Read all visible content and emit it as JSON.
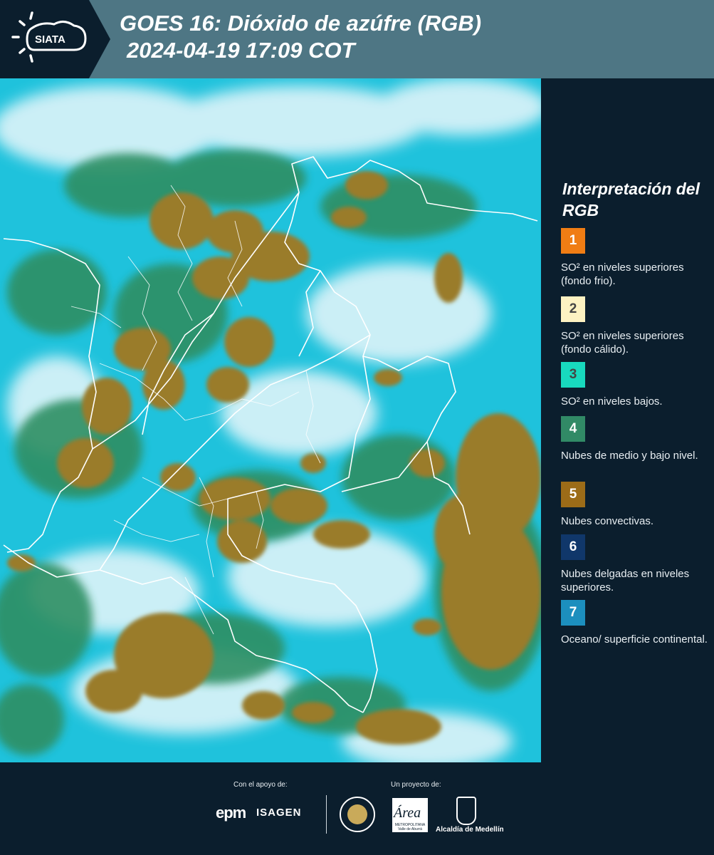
{
  "header": {
    "logo_text": "SIATA",
    "title_line1": "GOES 16: Dióxido de azúfre (RGB)",
    "title_line2": "2024-04-19 17:09 COT"
  },
  "legend": {
    "title": "Interpretación del RGB",
    "items": [
      {
        "number": "1",
        "color": "#f07d14",
        "text": "SO² en niveles superiores (fondo frio)."
      },
      {
        "number": "2",
        "color": "#fdf2c2",
        "text": "SO² en niveles superiores (fondo cálido)."
      },
      {
        "number": "3",
        "color": "#18d9be",
        "text": "SO² en niveles bajos."
      },
      {
        "number": "4",
        "color": "#318a66",
        "text": "Nubes de medio y bajo nivel."
      },
      {
        "number": "5",
        "color": "#9c6c18",
        "text": "Nubes convectivas."
      },
      {
        "number": "6",
        "color": "#10376a",
        "text": "Nubes delgadas en niveles superiores."
      },
      {
        "number": "7",
        "color": "#1c8fbe",
        "text": "Oceano/ superficie continental."
      }
    ]
  },
  "map": {
    "colors": {
      "surface": "#1fc2dc",
      "cloud_white": "#eaf7fb",
      "mid_low_cloud": "#2f8f63",
      "convective": "#9a7b2c",
      "borders": "#ffffff"
    }
  },
  "footer": {
    "support_label": "Con el apoyo de:",
    "project_label": "Un proyecto de:",
    "sponsor_1": "epm",
    "sponsor_2": "ISAGEN",
    "partner_area": "Área",
    "partner_area_sub": "METROPOLITANA Valle de Aburrá",
    "partner_alcaldia": "Alcaldía de Medellín"
  }
}
